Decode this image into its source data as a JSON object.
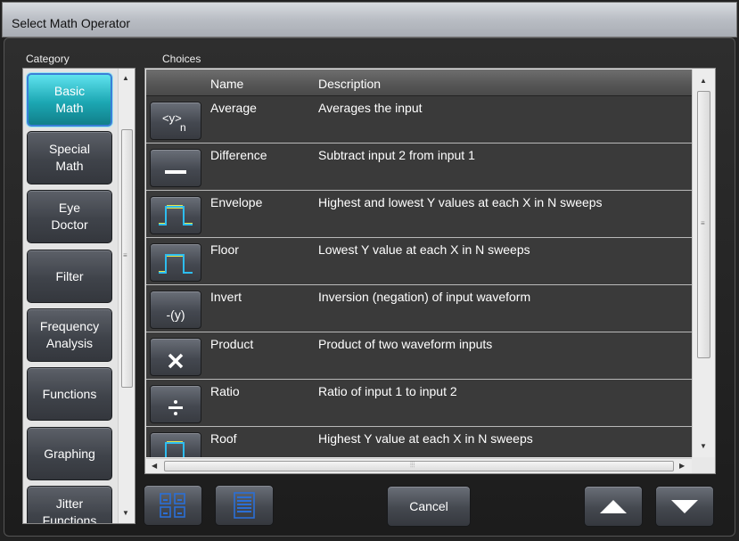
{
  "window": {
    "title": "Select Math Operator"
  },
  "category": {
    "label": "Category",
    "items": [
      {
        "label": "Basic\nMath",
        "active": true
      },
      {
        "label": "Special\nMath",
        "active": false
      },
      {
        "label": "Eye\nDoctor",
        "active": false
      },
      {
        "label": "Filter",
        "active": false
      },
      {
        "label": "Frequency\nAnalysis",
        "active": false
      },
      {
        "label": "Functions",
        "active": false
      },
      {
        "label": "Graphing",
        "active": false
      },
      {
        "label": "Jitter\nFunctions",
        "active": false
      }
    ]
  },
  "choices": {
    "label": "Choices",
    "columns": [
      "Name",
      "Description"
    ],
    "rows": [
      {
        "icon": "average-icon",
        "icon_text": "<y>",
        "name": "Average",
        "description": "Averages the input"
      },
      {
        "icon": "difference-icon",
        "icon_text": "",
        "name": "Difference",
        "description": "Subtract input 2 from input 1"
      },
      {
        "icon": "envelope-icon",
        "icon_text": "",
        "name": "Envelope",
        "description": "Highest and lowest Y values at each X in N sweeps"
      },
      {
        "icon": "floor-icon",
        "icon_text": "",
        "name": "Floor",
        "description": "Lowest Y value at each X in N sweeps"
      },
      {
        "icon": "invert-icon",
        "icon_text": "-(y)",
        "name": "Invert",
        "description": "Inversion (negation) of input waveform"
      },
      {
        "icon": "product-icon",
        "icon_text": "✕",
        "name": "Product",
        "description": "Product of two waveform inputs"
      },
      {
        "icon": "ratio-icon",
        "icon_text": "÷",
        "name": "Ratio",
        "description": "Ratio of input 1 to input 2"
      },
      {
        "icon": "roof-icon",
        "icon_text": "",
        "name": "Roof",
        "description": "Highest Y value at each X in N sweeps"
      }
    ]
  },
  "footer": {
    "cancel_label": "Cancel"
  },
  "colors": {
    "accent": "#1ca7b3",
    "waveform": "#2dbdf0",
    "waveform_fill": "#e6e64a"
  }
}
